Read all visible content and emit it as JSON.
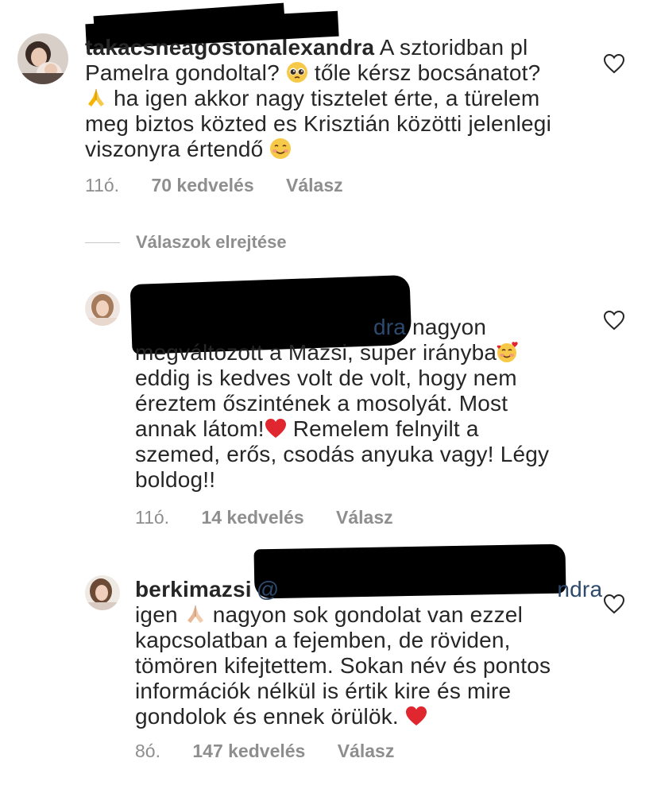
{
  "comments": [
    {
      "username": "takacsneagostonalexandra",
      "text_line1_rest": " A sztoridban pl",
      "text_line2_a": "Pamelra gondoltal? ",
      "text_line2_b": " tőle kérsz bocsánatot?",
      "text_line3": " ha igen akkor nagy tisztelet érte, a türelem",
      "text_line4": "meg biztos közted es Krisztián közötti jelenlegi",
      "text_line5": "viszonyra értendő ",
      "time": "11ó.",
      "likes": "70 kedvelés",
      "reply": "Válasz"
    },
    {
      "username": "",
      "mention_tail": "dra",
      "text_line1_rest": " nagyon",
      "text_line2": "megváltozott a Mazsi, super irányba",
      "text_line3": "eddig is kedves volt de volt, hogy nem",
      "text_line4": "éreztem őszintének a mosolyát. Most",
      "text_line5_a": "annak látom!",
      "text_line5_b": " Remelem felnyilt a",
      "text_line6": "szemed, erős, csodás anyuka vagy! Légy",
      "text_line7": "boldog!!",
      "time": "11ó.",
      "likes": "14 kedvelés",
      "reply": "Válasz"
    },
    {
      "username": "berkimazsi",
      "mention_head": "@",
      "mention_tail": "ndra",
      "text_line2_a": "igen ",
      "text_line2_b": " nagyon sok gondolat van ezzel",
      "text_line3": "kapcsolatban a fejemben, de röviden,",
      "text_line4": "tömören kifejtettem. Sokan név és pontos",
      "text_line5": "információk nélkül is értik kire és mire",
      "text_line6": "gondolok és ennek örülök. ",
      "time": "8ó.",
      "likes": "147 kedvelés",
      "reply": "Válasz"
    }
  ],
  "hide_replies_label": "Válaszok elrejtése",
  "icons": {
    "like": "heart-outline-icon",
    "emoji_pleading": "pleading-face-emoji",
    "emoji_pray": "folded-hands-emoji",
    "emoji_smiling": "smiling-face-emoji",
    "emoji_hearts": "smiling-face-with-hearts-emoji",
    "emoji_heart": "red-heart-emoji"
  },
  "colors": {
    "text": "#262626",
    "meta": "#8e8e8e",
    "mention": "#2d4a6e",
    "heart_red": "#e0262e"
  }
}
